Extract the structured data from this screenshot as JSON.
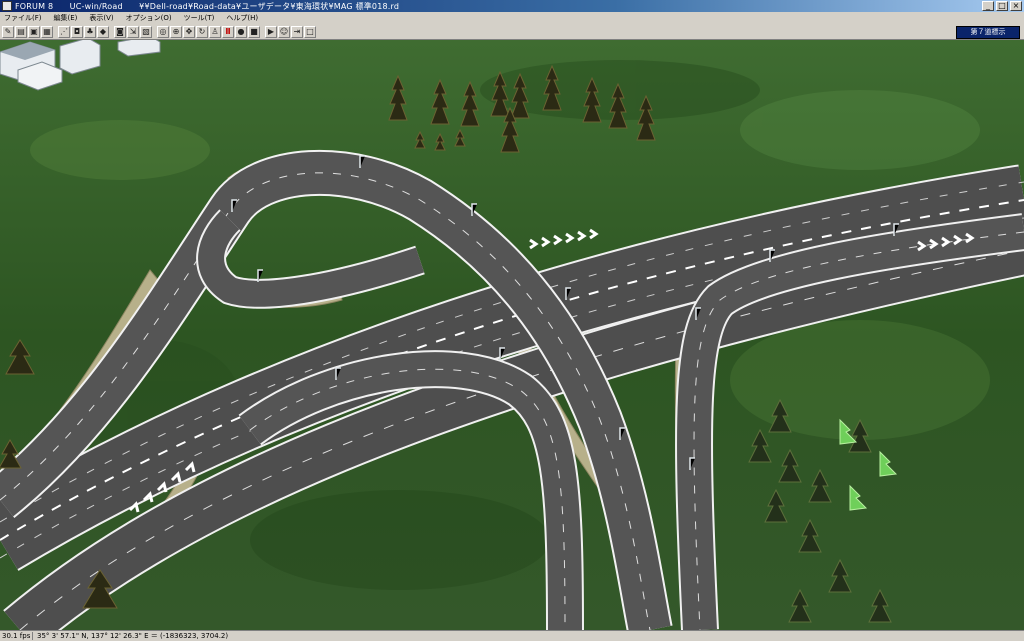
{
  "window": {
    "title": "FORUM 8　　UC-win/Road　　¥¥Dell-road¥Road-data¥ユーザデータ¥東海環状¥MAG 標準018.rd",
    "minimize_label": "_",
    "maximize_label": "□",
    "close_label": "×"
  },
  "menu": [
    {
      "label": "ファイル(F)"
    },
    {
      "label": "編集(E)"
    },
    {
      "label": "表示(V)"
    },
    {
      "label": "オプション(O)"
    },
    {
      "label": "ツール(T)"
    },
    {
      "label": "ヘルプ(H)"
    }
  ],
  "toolbar": {
    "view_button_label": "第７道標示",
    "icons": [
      "pencil",
      "open",
      "save",
      "grid",
      "sep",
      "road",
      "car",
      "tree",
      "shield",
      "sep",
      "camera",
      "export",
      "map",
      "sep",
      "target",
      "zoom",
      "move",
      "rotate",
      "walk",
      "pause",
      "record",
      "stop",
      "sep",
      "run",
      "person",
      "drive",
      "box"
    ]
  },
  "status": {
    "fps": "30.1 fps",
    "coords": "35° 3' 57.1\" N, 137° 12' 26.3\" E  ＝ (-1836323, 3704.2)"
  },
  "colors": {
    "accent": "#0a246a",
    "road": "#4e4e4e",
    "embankment": "#b7b08a",
    "terrain": "#2f5a24"
  }
}
